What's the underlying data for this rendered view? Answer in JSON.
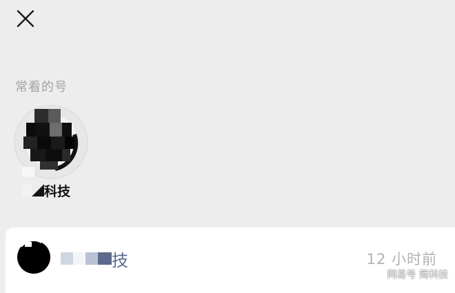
{
  "header": {
    "close_icon": "close-icon"
  },
  "frequent_section": {
    "title": "常看的号",
    "account": {
      "name_visible": "科技",
      "avatar": "pixelated-avatar"
    }
  },
  "list": {
    "item": {
      "name_visible": "技",
      "time": "12 小时前",
      "avatar": "pixelated-avatar"
    }
  },
  "watermark": "网易号 简科技",
  "colors": {
    "background": "#ededed",
    "card": "#ffffff",
    "link_blue": "#576b95",
    "muted_gray": "#a3a3a3",
    "time_gray": "#b2b2b2"
  }
}
